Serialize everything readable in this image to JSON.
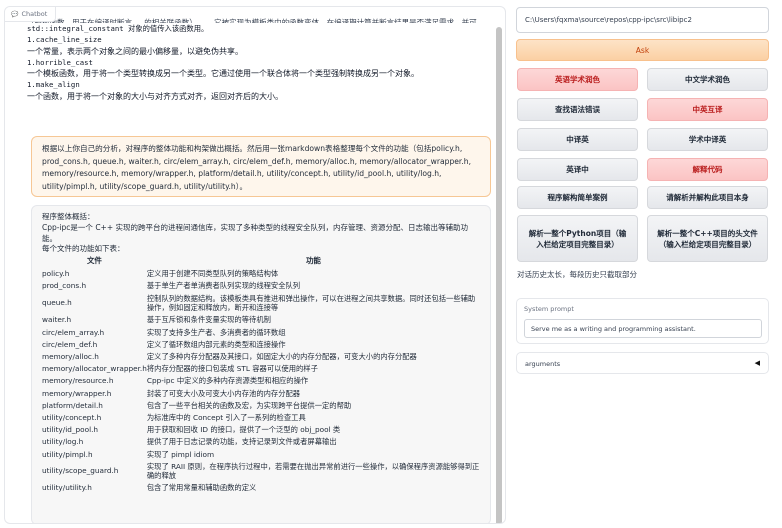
{
  "chatbot": {
    "label": "Chatbot",
    "top_lines": {
      "clipped": "（模板函数，用于在编译时断言 … 的相关联函数）…… 它被实现为模板类中的函数变体，在编译期计算并断言结果是否满足需求，并可检查 …",
      "line0": "std::integral_constant 对象的值传入该函数用。",
      "item1_title": "1.cache_line_size",
      "item1_desc": "一个常量，表示两个对象之间的最小偏移量，以避免伪共享。",
      "item2_title": "1.horrible_cast",
      "item2_desc": "一个模板函数，用于将一个类型转换成另一个类型。它通过使用一个联合体将一个类型强制转换成另一个对象。",
      "item3_title": "1.make_align",
      "item3_desc": "一个函数，用于将一个对象的大小与对齐方式对齐，返回对齐后的大小。"
    },
    "user_message": "根据以上你自己的分析，对程序的整体功能和构架做出概括。然后用一张markdown表格整理每个文件的功能（包括policy.h, prod_cons.h, queue.h, waiter.h, circ/elem_array.h, circ/elem_def.h, memory/alloc.h, memory/allocator_wrapper.h, memory/resource.h, memory/wrapper.h, platform/detail.h, utility/concept.h, utility/id_pool.h, utility/log.h, utility/pimpl.h, utility/scope_guard.h, utility/utility.h）。",
    "bot_reply": {
      "intro_label": "程序整体概括：",
      "intro": "Cpp-ipc是一个 C++ 实现的跨平台的进程间通信库，实现了多种类型的线程安全队列，内存管理、资源分配、日志输出等辅助功能。",
      "table_intro": "每个文件的功能如下表：",
      "headers": [
        "文件",
        "功能"
      ],
      "rows": [
        {
          "file": "policy.h",
          "desc": "定义用于创建不同类型队列的策略结构体"
        },
        {
          "file": "prod_cons.h",
          "desc": "基于单生产者单消费者队列实现的线程安全队列"
        },
        {
          "file": "queue.h",
          "desc": "控制队列的数据结构。该模板类具有推进和弹出操作，可以在进程之间共享数据。同时还包括一些辅助操作，例如固定和释放内，断开和连接等"
        },
        {
          "file": "waiter.h",
          "desc": "基于互斥锁和条件变量实现的等待机制"
        },
        {
          "file": "circ/elem_array.h",
          "desc": "实现了支持多生产者、多消费者的循环数组"
        },
        {
          "file": "circ/elem_def.h",
          "desc": "定义了循环数组内部元素的类型和连接操作"
        },
        {
          "file": "memory/alloc.h",
          "desc": "定义了多种内存分配器及其接口，如固定大小的内存分配器，可变大小的内存分配器"
        },
        {
          "file": "memory/allocator_wrapper.h",
          "desc": "将内存分配器的接口包装成 STL 容器可以使用的样子"
        },
        {
          "file": "memory/resource.h",
          "desc": "Cpp-ipc 中定义的多种内存资源类型和相应的操作"
        },
        {
          "file": "memory/wrapper.h",
          "desc": "封装了可变大小及可变大小内存池的内存分配器"
        },
        {
          "file": "platform/detail.h",
          "desc": "包含了一些平台相关的函数及宏，为实现跨平台提供一定的帮助"
        },
        {
          "file": "utility/concept.h",
          "desc": "为标准库中的 Concept 引入了一系列的检查工具"
        },
        {
          "file": "utility/id_pool.h",
          "desc": "用于获取和回收 ID 的接口，提供了一个泛型的 obj_pool 类"
        },
        {
          "file": "utility/log.h",
          "desc": "提供了用于日志记录的功能，支持记录到文件或者屏幕输出"
        },
        {
          "file": "utility/pimpl.h",
          "desc": "实现了 pimpl idiom"
        },
        {
          "file": "utility/scope_guard.h",
          "desc": "实现了 RAII 原则，在程序执行过程中，若需要在抛出异常前进行一些操作，以确保程序资源能够得到正确的释放"
        },
        {
          "file": "utility/utility.h",
          "desc": "包含了常用常量和辅助函数的定义"
        }
      ]
    }
  },
  "controls": {
    "path_value": "C:\\Users\\fqxma\\source\\repos\\cpp-ipc\\src\\libipc2",
    "ask_label": "Ask",
    "buttons": {
      "b1": "英语学术润色",
      "b2": "中文学术润色",
      "b3": "查找语法错误",
      "b4": "中英互译",
      "b5": "中译英",
      "b6": "学术中译英",
      "b7": "英译中",
      "b8": "解释代码",
      "b9": "程序解构简单案例",
      "b10": "请解析并解构此项目本身",
      "b11": "解析一整个Python项目（输入栏给定项目完整目录）",
      "b12": "解析一整个C++项目的头文件（输入栏给定项目完整目录）"
    },
    "hint": "对话历史太长，每段历史只截取部分",
    "system_prompt": {
      "label": "System prompt",
      "value": "Serve me as a writing and programming assistant."
    },
    "arguments_label": "arguments"
  },
  "colors": {
    "accent_orange": "#f8c18d",
    "accent_red": "#fbc4c4",
    "gray_button": "#e5e7eb",
    "user_bubble": "#fef6ec"
  }
}
